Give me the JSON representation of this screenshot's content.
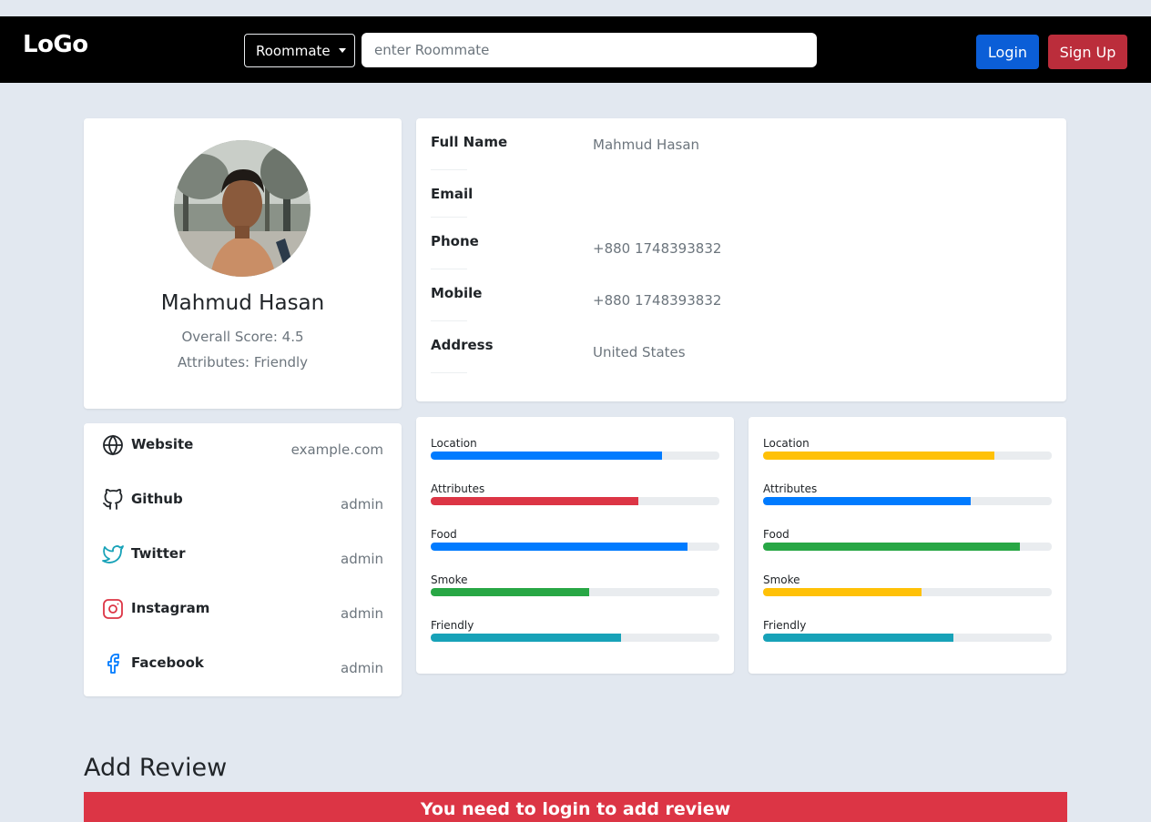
{
  "navbar": {
    "logo": "LoGo",
    "dropdown_label": "Roommate",
    "search_placeholder": "enter Roommate",
    "login_label": "Login",
    "signup_label": "Sign Up"
  },
  "profile": {
    "name": "Mahmud Hasan",
    "score": "Overall Score: 4.5",
    "attributes": "Attributes: Friendly"
  },
  "info": {
    "rows": [
      {
        "label": "Full Name",
        "value": "Mahmud Hasan"
      },
      {
        "label": "Email",
        "value": ""
      },
      {
        "label": "Phone",
        "value": "+880 1748393832"
      },
      {
        "label": "Mobile",
        "value": "+880 1748393832"
      },
      {
        "label": "Address",
        "value": "United States"
      }
    ]
  },
  "social": {
    "items": [
      {
        "label": "Website",
        "value": "example.com",
        "icon": "globe-icon"
      },
      {
        "label": "Github",
        "value": "admin",
        "icon": "github-icon"
      },
      {
        "label": "Twitter",
        "value": "admin",
        "icon": "twitter-icon"
      },
      {
        "label": "Instagram",
        "value": "admin",
        "icon": "instagram-icon"
      },
      {
        "label": "Facebook",
        "value": "admin",
        "icon": "facebook-icon"
      }
    ]
  },
  "ratings_left": [
    {
      "label": "Location",
      "value": 80,
      "color": "#007bff"
    },
    {
      "label": "Attributes",
      "value": 72,
      "color": "#dc3545"
    },
    {
      "label": "Food",
      "value": 89,
      "color": "#007bff"
    },
    {
      "label": "Smoke",
      "value": 55,
      "color": "#28a745"
    },
    {
      "label": "Friendly",
      "value": 66,
      "color": "#17a2b8"
    }
  ],
  "ratings_right": [
    {
      "label": "Location",
      "value": 80,
      "color": "#ffc107"
    },
    {
      "label": "Attributes",
      "value": 72,
      "color": "#007bff"
    },
    {
      "label": "Food",
      "value": 89,
      "color": "#28a745"
    },
    {
      "label": "Smoke",
      "value": 55,
      "color": "#ffc107"
    },
    {
      "label": "Friendly",
      "value": 66,
      "color": "#17a2b8"
    }
  ],
  "review": {
    "title": "Add Review",
    "alert": "You need to login to add review"
  }
}
